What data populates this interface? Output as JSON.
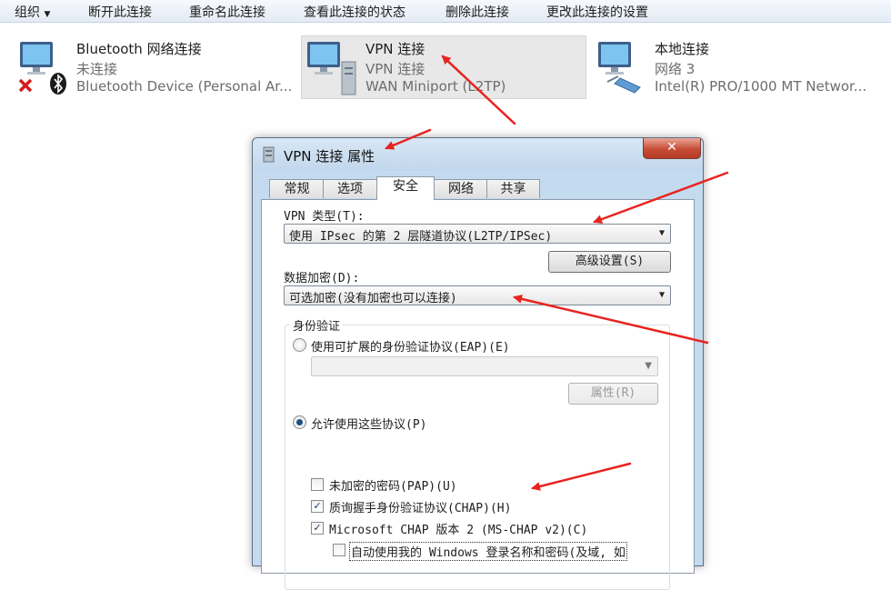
{
  "toolbar": {
    "organize": "组织",
    "organize_arrow": "▼",
    "disconnect": "断开此连接",
    "rename": "重命名此连接",
    "view_status": "查看此连接的状态",
    "delete": "删除此连接",
    "change_settings": "更改此连接的设置"
  },
  "connections": [
    {
      "name": "Bluetooth 网络连接",
      "status": "未连接",
      "device": "Bluetooth Device (Personal Ar..."
    },
    {
      "name": "VPN 连接",
      "status": "VPN 连接",
      "device": "WAN Miniport (L2TP)"
    },
    {
      "name": "本地连接",
      "status": "网络  3",
      "device": "Intel(R) PRO/1000 MT Networ..."
    }
  ],
  "dialog": {
    "title": "VPN 连接 属性",
    "close": "✕",
    "tabs": [
      "常规",
      "选项",
      "安全",
      "网络",
      "共享"
    ],
    "vpn_type_label": "VPN 类型(T):",
    "vpn_type_value": "使用 IPsec 的第 2 层隧道协议(L2TP/IPSec)",
    "advanced_button": "高级设置(S)",
    "encryption_label": "数据加密(D):",
    "encryption_value": "可选加密(没有加密也可以连接)",
    "auth_group_label": "身份验证",
    "eap_radio": "使用可扩展的身份验证协议(EAP)(E)",
    "eap_properties_button": "属性(R)",
    "allow_protocols_radio": "允许使用这些协议(P)",
    "protocols": [
      {
        "label": "未加密的密码(PAP)(U)",
        "checked": false
      },
      {
        "label": "质询握手身份验证协议(CHAP)(H)",
        "checked": true
      },
      {
        "label": "Microsoft CHAP 版本 2 (MS-CHAP v2)(C)",
        "checked": true
      }
    ],
    "auto_windows_login": "自动使用我的 Windows 登录名称和密码(及域, 如"
  },
  "colors": {
    "annotation_arrow": "#e8231f",
    "dialog_frame": "#c4daef",
    "selection": "#e8e8e8"
  }
}
